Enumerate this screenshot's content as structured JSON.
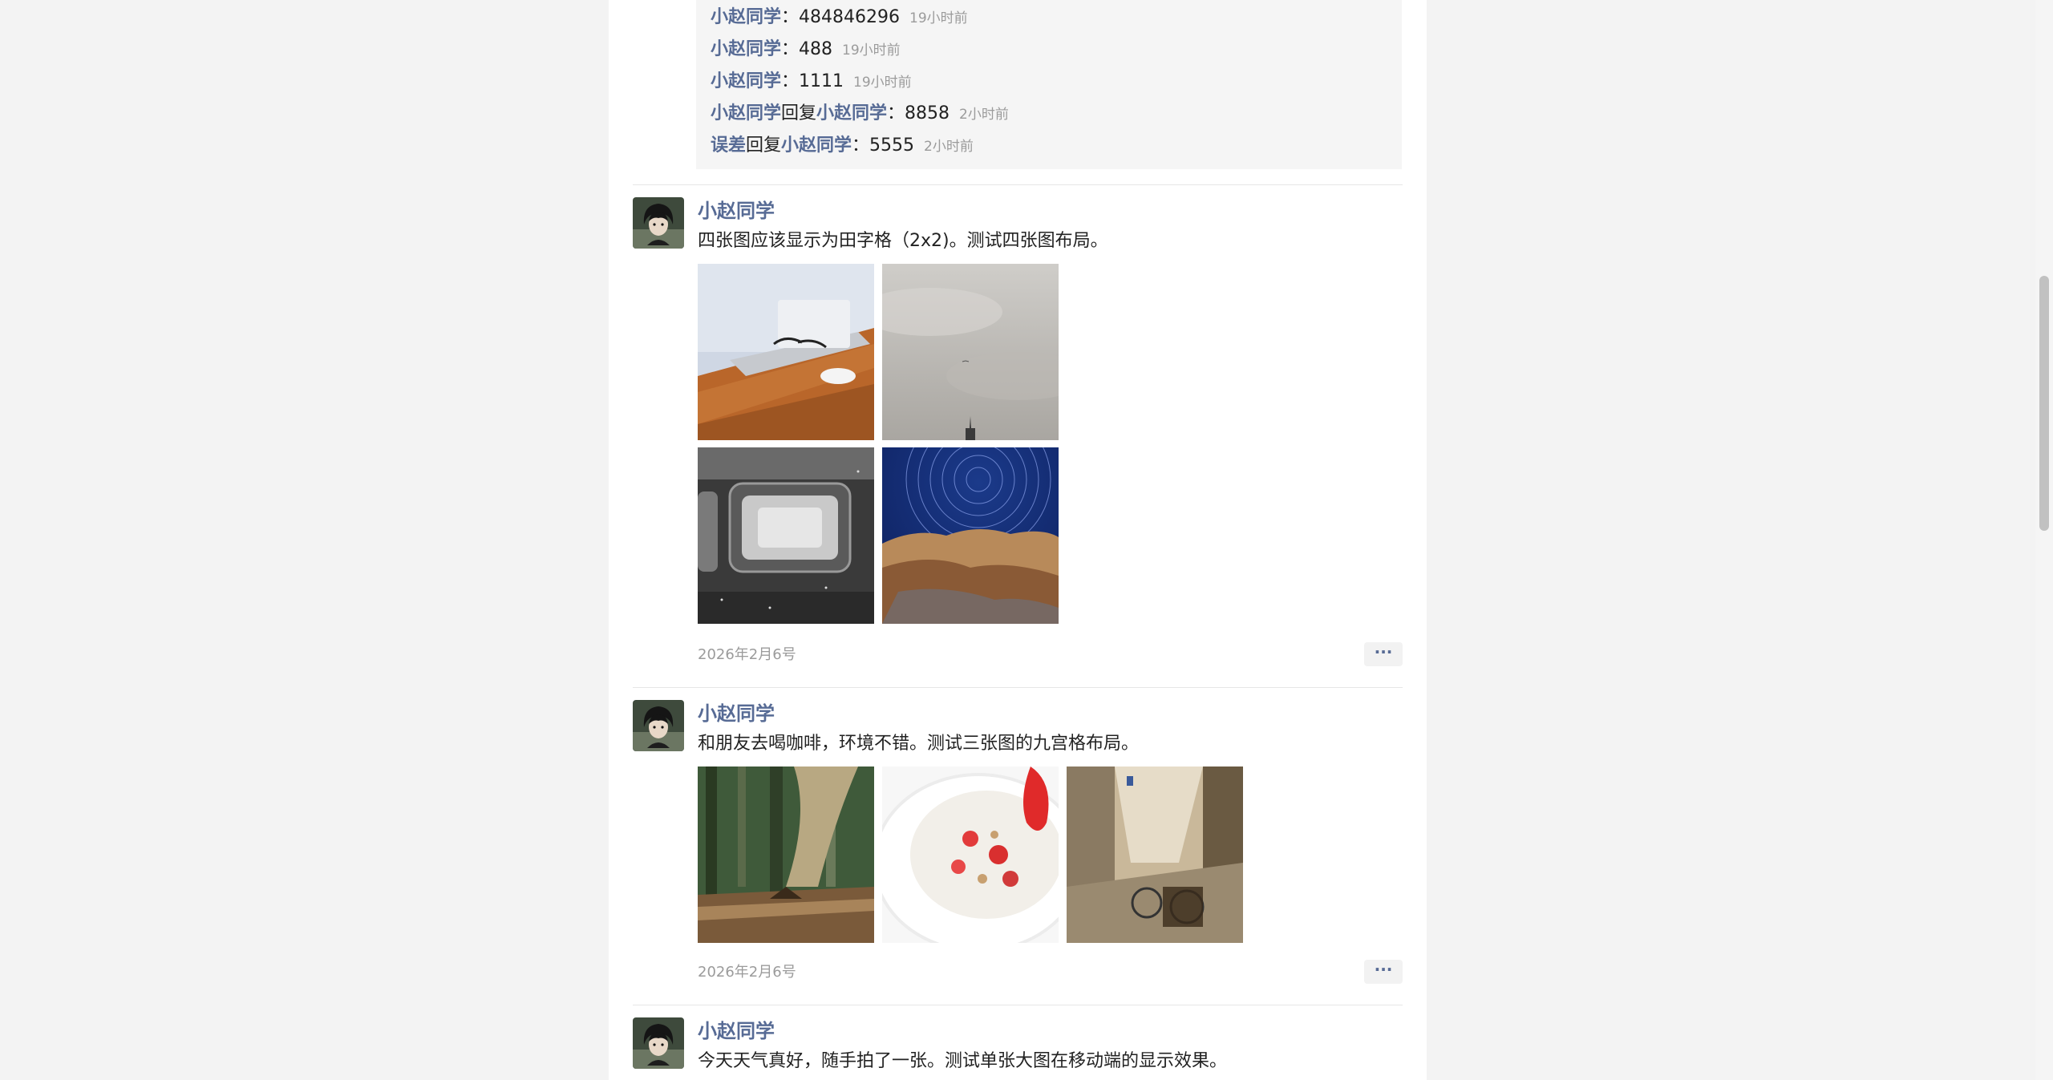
{
  "comments": [
    {
      "name": "小赵同学",
      "reply_word": "",
      "reply_to": "",
      "text": "：484846296",
      "time": "19小时前"
    },
    {
      "name": "小赵同学",
      "reply_word": "",
      "reply_to": "",
      "text": "：488",
      "time": "19小时前"
    },
    {
      "name": "小赵同学",
      "reply_word": "",
      "reply_to": "",
      "text": "：1111",
      "time": "19小时前"
    },
    {
      "name": "小赵同学",
      "reply_word": "回复",
      "reply_to": "小赵同学",
      "text": "：8858",
      "time": "2小时前"
    },
    {
      "name": "误差",
      "reply_word": "回复",
      "reply_to": "小赵同学",
      "text": "：5555",
      "time": "2小时前"
    }
  ],
  "posts": [
    {
      "author": "小赵同学",
      "text": "四张图应该显示为田字格（2x2)。测试四张图布局。",
      "images": [
        "laptop-glasses-desk-photo",
        "cloudy-sky-spire-photo",
        "train-window-photo",
        "star-trails-rocks-photo"
      ],
      "date": "2026年2月6号",
      "more_label": "···"
    },
    {
      "author": "小赵同学",
      "text": "和朋友去喝咖啡，环境不错。测试三张图的九宫格布局。",
      "images": [
        "forest-boardwalk-photo",
        "yogurt-strawberry-photo",
        "street-bicycles-photo"
      ],
      "date": "2026年2月6号",
      "more_label": "···"
    },
    {
      "author": "小赵同学",
      "text": "今天天气真好，随手拍了一张。测试单张大图在移动端的显示效果。"
    }
  ],
  "colors": {
    "name_link": "#576b95",
    "timestamp": "#9b9b9b",
    "background": "#f3f3f3"
  }
}
